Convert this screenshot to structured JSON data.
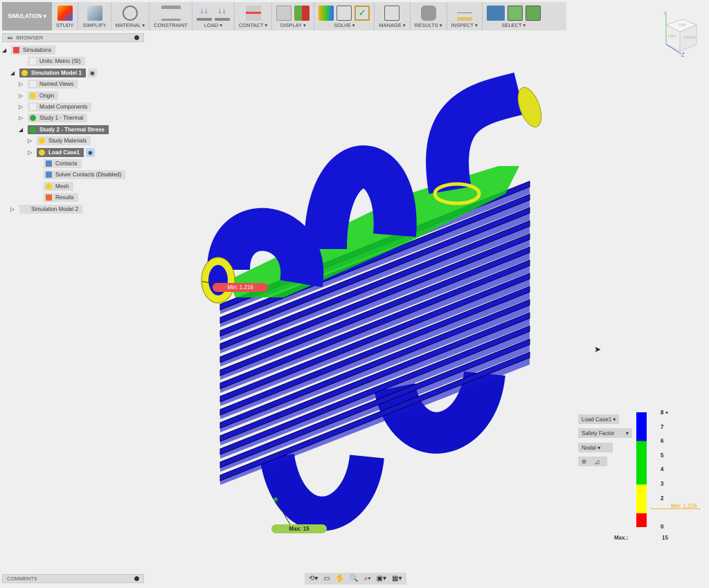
{
  "toolbar": {
    "workspace": "SIMULATION ▾",
    "groups": [
      "STUDY",
      "SIMPLIFY",
      "MATERIAL ▾",
      "CONSTRAINT",
      "LOAD ▾",
      "CONTACT ▾",
      "DISPLAY ▾",
      "SOLVE ▾",
      "MANAGE ▾",
      "RESULTS ▾",
      "INSPECT ▾",
      "SELECT ▾"
    ]
  },
  "viewcube": {
    "top": "TOP",
    "left": "LEFT",
    "front": "FRONT",
    "y": "Y",
    "z": "Z"
  },
  "browser": {
    "title": "BROWSER",
    "items": [
      {
        "label": "Simulations"
      },
      {
        "label": "Units: Metric (SI)"
      },
      {
        "label": "Simulation Model 1"
      },
      {
        "label": "Named Views"
      },
      {
        "label": "Origin"
      },
      {
        "label": "Model Components"
      },
      {
        "label": "Study 1 - Thermal"
      },
      {
        "label": "Study 2 - Thermal Stress"
      },
      {
        "label": "Study Materials"
      },
      {
        "label": "Load Case1"
      },
      {
        "label": "Contacts"
      },
      {
        "label": "Solver Contacts (Disabled)"
      },
      {
        "label": "Mesh"
      },
      {
        "label": "Results"
      },
      {
        "label": "Simulation Model 2"
      }
    ]
  },
  "comments": {
    "title": "COMMENTS"
  },
  "probes": {
    "min": "Min: 1.216",
    "max": "Max: 15"
  },
  "legend": {
    "load_case": "Load Case1 ▾",
    "result_type": "Safety Factor",
    "mode": "Nodal ▾",
    "ticks": [
      "8 +",
      "7",
      "6",
      "5",
      "4",
      "3",
      "2",
      "0"
    ],
    "min_label": "Min: 1.216",
    "max_label": "Max.:",
    "max_value": "15",
    "colors": {
      "blue": "#0000ff",
      "green": "#00e000",
      "yellow": "#ffff00",
      "red": "#ff0000"
    }
  }
}
